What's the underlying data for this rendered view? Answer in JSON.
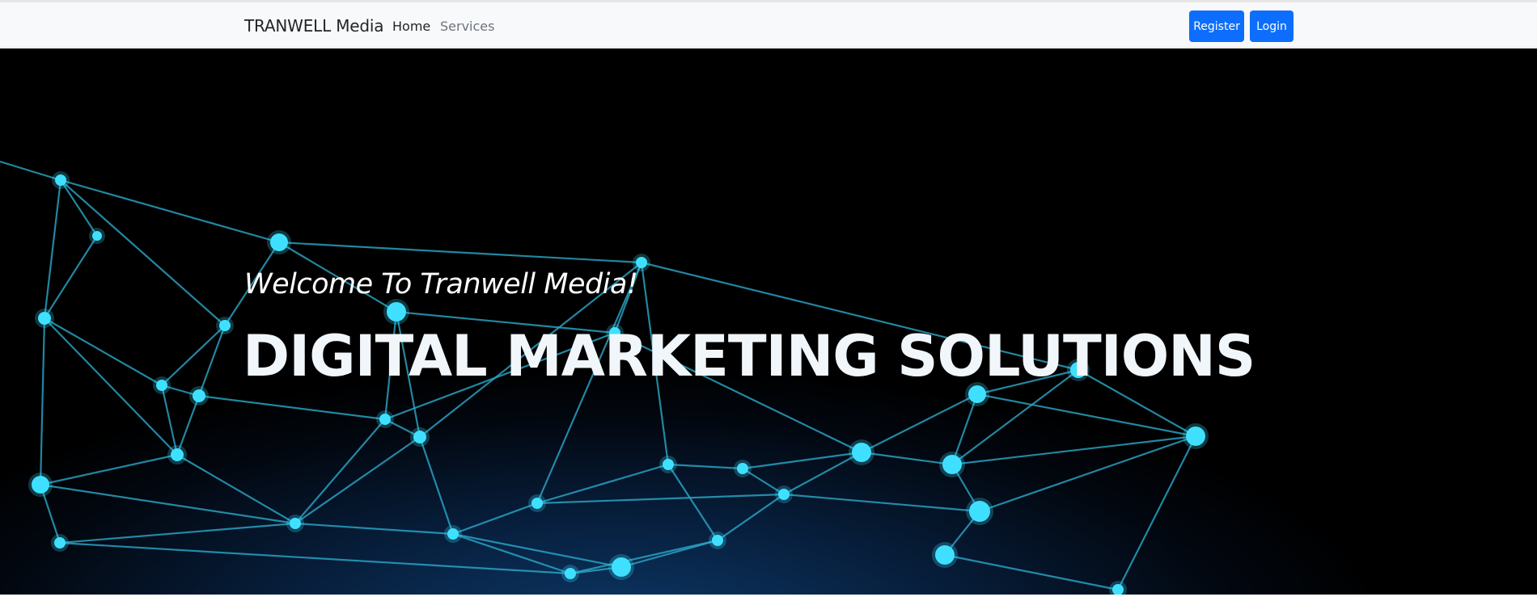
{
  "navbar": {
    "brand": "TRANWELL Media",
    "links": [
      {
        "label": "Home",
        "active": true
      },
      {
        "label": "Services",
        "active": false
      }
    ],
    "buttons": {
      "register": "Register",
      "login": "Login"
    }
  },
  "hero": {
    "welcome": "Welcome To Tranwell Media!",
    "headline": "DIGITAL MARKETING SOLUTIONS",
    "background": "network-mesh-image"
  },
  "colors": {
    "primary": "#0d6efd",
    "navbar_bg": "#f8f9fa",
    "hero_bg": "#000000",
    "network_node": "#3fe0ff",
    "network_line": "#2aa9c9"
  }
}
